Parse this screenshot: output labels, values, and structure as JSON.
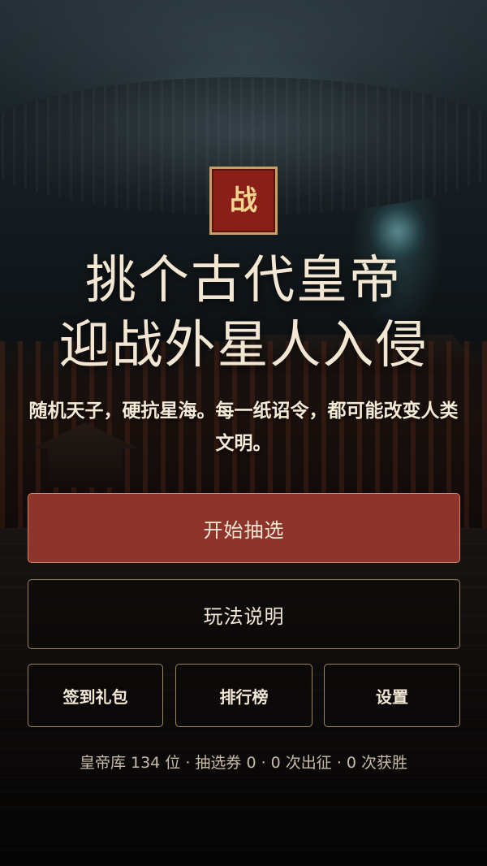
{
  "badge": {
    "text": "战"
  },
  "hero": {
    "title_line1": "挑个古代皇帝",
    "title_line2": "迎战外星人入侵",
    "subtitle": "随机天子，硬抗星海。每一纸诏令，都可能改变人类文明。"
  },
  "actions": {
    "start_draw": "开始抽选",
    "how_to_play": "玩法说明",
    "signin_gift": "签到礼包",
    "leaderboard": "排行榜",
    "settings": "设置"
  },
  "stats": {
    "summary": "皇帝库 134 位 · 抽选券 0 · 0 次出征 · 0 次获胜"
  },
  "colors": {
    "accent_red": "#8f342a",
    "badge_red": "#8a1f1a",
    "gold_border": "#c9a064",
    "text_cream": "#f3e7d3"
  }
}
